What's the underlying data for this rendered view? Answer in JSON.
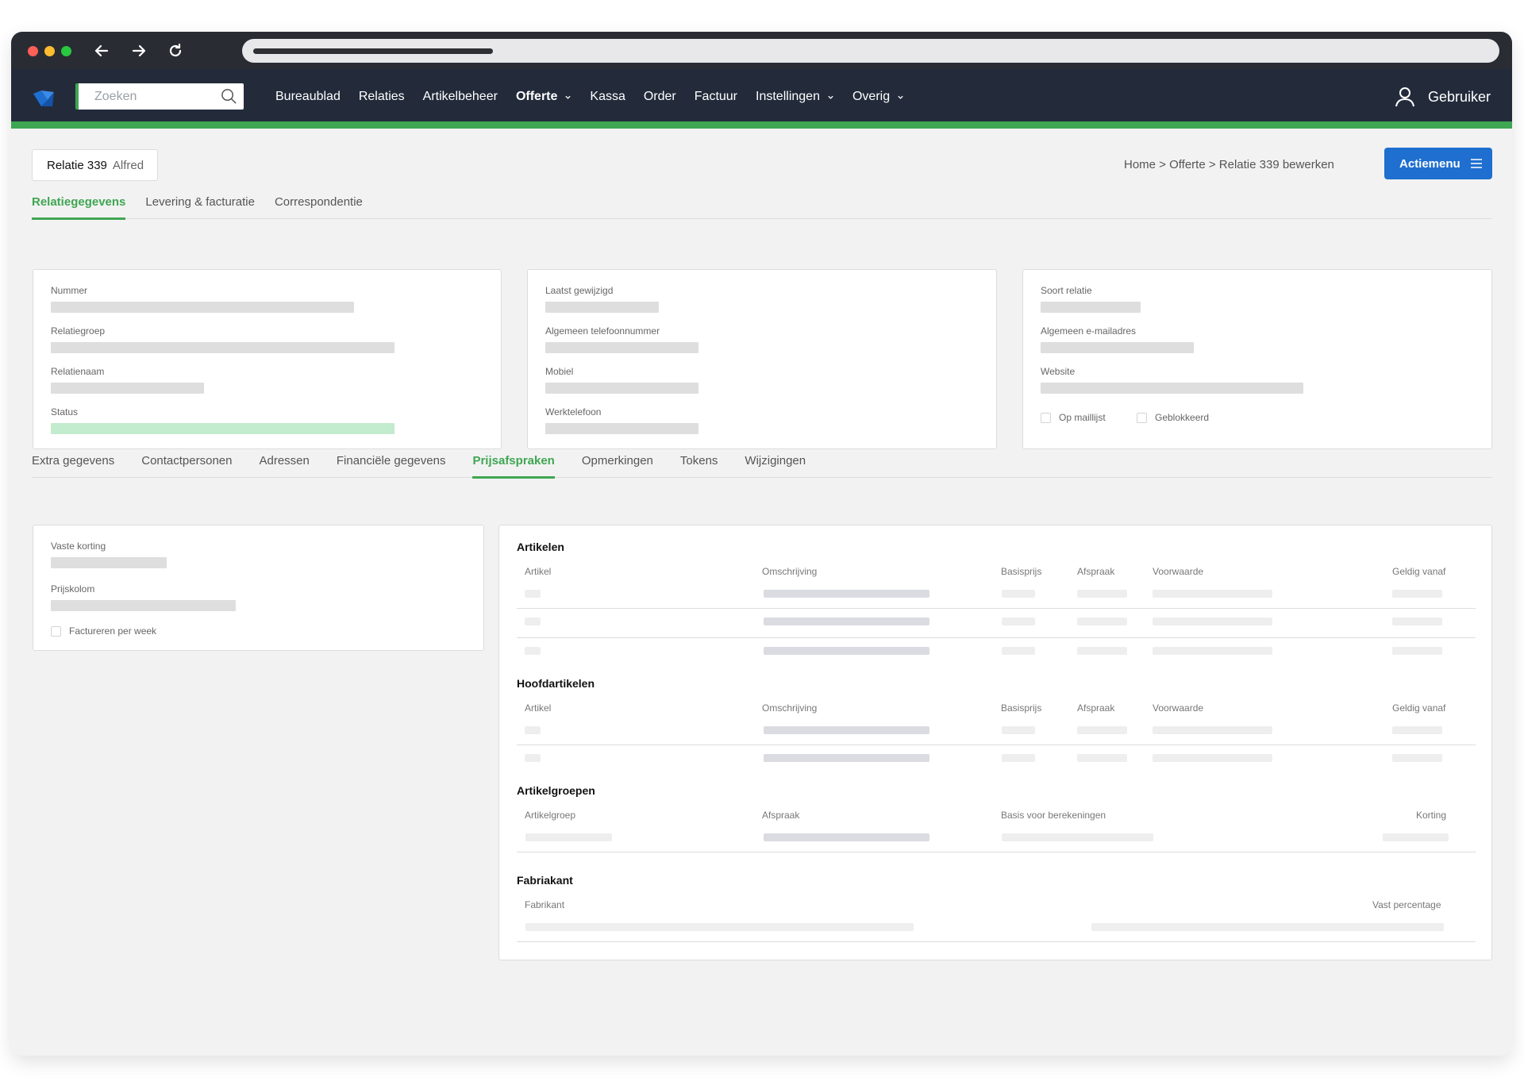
{
  "app": {
    "search": {
      "placeholder": "Zoeken"
    },
    "menu": [
      {
        "label": "Bureaublad",
        "active": false,
        "dropdown": false
      },
      {
        "label": "Relaties",
        "active": false,
        "dropdown": false
      },
      {
        "label": "Artikelbeheer",
        "active": false,
        "dropdown": false
      },
      {
        "label": "Offerte",
        "active": true,
        "dropdown": true
      },
      {
        "label": "Kassa",
        "active": false,
        "dropdown": false
      },
      {
        "label": "Order",
        "active": false,
        "dropdown": false
      },
      {
        "label": "Factuur",
        "active": false,
        "dropdown": false
      },
      {
        "label": "Instellingen",
        "active": false,
        "dropdown": true
      },
      {
        "label": "Overig",
        "active": false,
        "dropdown": true
      }
    ],
    "user": {
      "label": "Gebruiker"
    },
    "accent": "#3fa652",
    "header_bg": "#232b3b"
  },
  "page": {
    "relation_number": "Relatie 339",
    "relation_name": "Alfred",
    "breadcrumb": "Home > Offerte > Relatie 339 bewerken",
    "action_button": "Actiemenu",
    "top_tabs": [
      "Relatiegegevens",
      "Levering & facturatie",
      "Correspondentie"
    ],
    "top_tab_active": "Relatiegegevens",
    "card1": {
      "labels": [
        "Nummer",
        "Relatiegroep",
        "Relatienaam",
        "Status"
      ]
    },
    "card2": {
      "labels": [
        "Laatst gewijzigd",
        "Algemeen telefoonnummer",
        "Mobiel",
        "Werktelefoon"
      ]
    },
    "card3": {
      "labels": [
        "Soort relatie",
        "Algemeen e-mailadres",
        "Website"
      ],
      "checkboxes": [
        "Op maillijst",
        "Geblokkeerd"
      ]
    },
    "bottom_tabs": [
      "Extra gegevens",
      "Contactpersonen",
      "Adressen",
      "Financiële gegevens",
      "Prijsafspraken",
      "Opmerkingen",
      "Tokens",
      "Wijzigingen"
    ],
    "bottom_tab_active": "Prijsafspraken",
    "left_card": {
      "labels": [
        "Vaste korting",
        "Prijskolom"
      ],
      "checkbox": "Factureren per week"
    },
    "sections": {
      "artikelen": {
        "title": "Artikelen",
        "columns": [
          "Artikel",
          "Omschrijving",
          "Basisprijs",
          "Afspraak",
          "Voorwaarde",
          "Geldig vanaf"
        ]
      },
      "hoofdartikelen": {
        "title": "Hoofdartikelen",
        "columns": [
          "Artikel",
          "Omschrijving",
          "Basisprijs",
          "Afspraak",
          "Voorwaarde",
          "Geldig vanaf"
        ]
      },
      "artikelgroepen": {
        "title": "Artikelgroepen",
        "columns": [
          "Artikelgroep",
          "Afspraak",
          "Basis voor berekeningen",
          "Korting"
        ]
      },
      "fabriakant": {
        "title": "Fabriakant",
        "columns": [
          "Fabrikant",
          "Vast percentage"
        ]
      }
    }
  }
}
